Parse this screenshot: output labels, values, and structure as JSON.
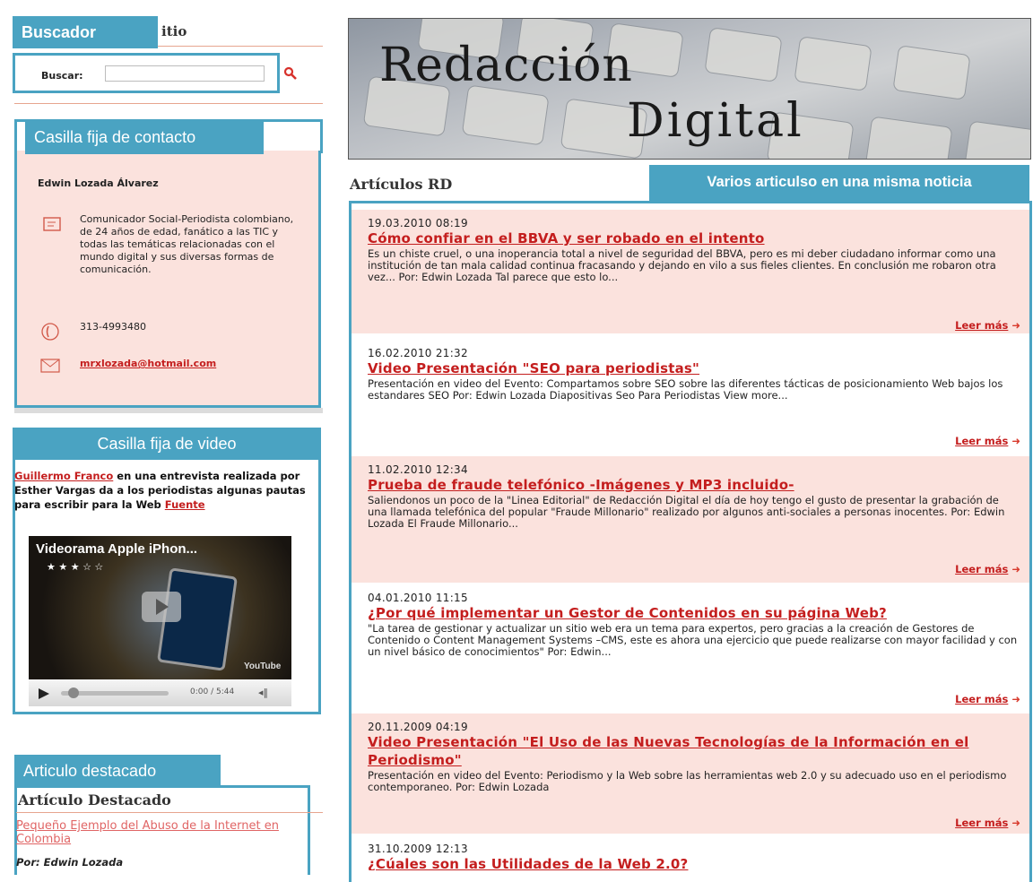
{
  "sidebar": {
    "search": {
      "tab_label": "Buscador",
      "title_suffix": "itio",
      "label": "Buscar:",
      "placeholder": "",
      "search_icon": "magnifier-icon"
    },
    "contact": {
      "tab_label": "Casilla fija de contacto",
      "name": "Edwin Lozada Álvarez",
      "bio": "Comunicador Social-Periodista colombiano, de 24 años de edad, fanático a las TIC y todas las temáticas relacionadas con el mundo digital y sus diversas formas de comunicación.",
      "phone": "313-4993480",
      "email": "mrxlozada@hotmail.com"
    },
    "video": {
      "tab_label": "Casilla  fija de video",
      "link_name": "Guillermo Franco",
      "text_1": " en una entrevista realizada por Esther Vargas da a los periodistas algunas pautas para escribir para la Web ",
      "source_link": "Fuente",
      "player_title": "Videorama Apple iPhon...",
      "time": "0:00 / 5:44",
      "youtube": "YouTube"
    },
    "featured": {
      "tab_label": "Articulo destacado",
      "heading": "Artículo Destacado",
      "link": "Pequeño Ejemplo del Abuso de la Internet en Colombia",
      "author": "Por: Edwin Lozada"
    }
  },
  "header": {
    "banner_line1": "Redacción",
    "banner_line2": "Digital"
  },
  "articles_section": {
    "title": "Artículos RD",
    "tab_label": "Varios articulso en una misma noticia",
    "read_more": "Leer más",
    "items": [
      {
        "date": "19.03.2010 08:19",
        "title": "Cómo confiar en el BBVA y ser robado en el intento",
        "summary": "Es un chiste cruel, o una inoperancia total a nivel de seguridad del BBVA, pero es mi deber ciudadano informar como una institución de tan mala calidad continua fracasando y dejando en vilo a sus fieles clientes. En conclusión me robaron otra vez... Por: Edwin Lozada   Tal parece que esto lo..."
      },
      {
        "date": "16.02.2010 21:32",
        "title": "Video Presentación \"SEO para periodistas\"",
        "summary": " Presentación en video del Evento: Compartamos sobre SEO sobre las diferentes tácticas de posicionamiento Web bajos los estandares SEO Por: Edwin Lozada   Diapositivas Seo Para Periodistas View more..."
      },
      {
        "date": "11.02.2010 12:34",
        "title": "Prueba de fraude telefónico -Imágenes y MP3 incluido-",
        "summary": "Saliendonos un poco de la \"Linea Editorial\" de Redacción Digital el día de hoy tengo el gusto de presentar la grabación de una llamada telefónica del popular \"Fraude Millonario\" realizado por algunos anti-sociales  a personas inocentes.   Por: Edwin Lozada   El Fraude Millonario..."
      },
      {
        "date": "04.01.2010 11:15",
        "title": "¿Por qué implementar un Gestor de Contenidos en su página Web?",
        "summary": " \"La tarea de gestionar y actualizar un sitio web era un tema para expertos, pero gracias a la creación de Gestores de Contenido o Content Management Systems –CMS, este es ahora una ejercicio que puede realizarse con mayor facilidad y con un nivel básico de conocimientos\"   Por: Edwin..."
      },
      {
        "date": "20.11.2009 04:19",
        "title": "Video Presentación \"El Uso de las Nuevas Tecnologías de la Información en el Periodismo\"",
        "summary": "Presentación en video del Evento: Periodismo y la Web sobre las herramientas web 2.0 y su adecuado uso en el periodismo contemporaneo. Por: Edwin Lozada"
      },
      {
        "date": "31.10.2009 12:13",
        "title": "¿Cúales son las Utilidades de la Web 2.0?",
        "summary": ""
      }
    ]
  },
  "colors": {
    "accent": "#4aa3c2",
    "pink_bg": "#fbe2dd",
    "link_red": "#c41e1e"
  }
}
